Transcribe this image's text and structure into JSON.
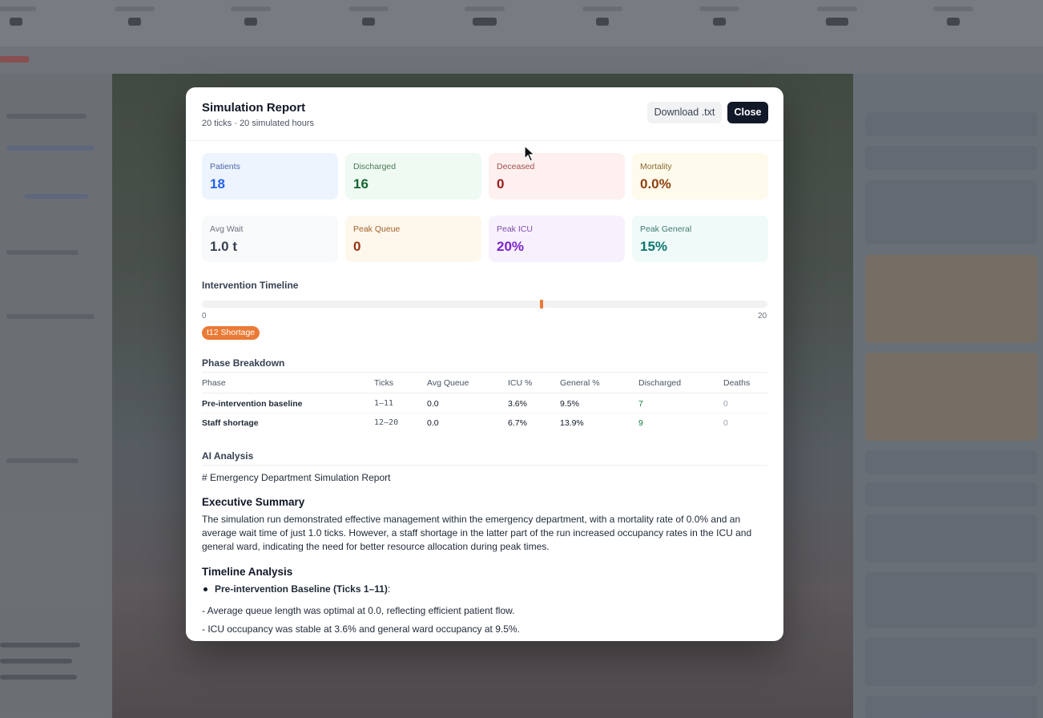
{
  "modal": {
    "title": "Simulation Report",
    "subtitle": "20 ticks · 20 simulated hours",
    "download_label": "Download .txt",
    "close_label": "Close"
  },
  "stats": [
    {
      "label": "Patients",
      "value": "18",
      "label_color": "#4b64a8",
      "value_color": "#2563eb",
      "bg": "#eef4fd"
    },
    {
      "label": "Discharged",
      "value": "16",
      "label_color": "#4b7a58",
      "value_color": "#166534",
      "bg": "#effaf2"
    },
    {
      "label": "Deceased",
      "value": "0",
      "label_color": "#a0504e",
      "value_color": "#991b1b",
      "bg": "#fdf0ef"
    },
    {
      "label": "Mortality",
      "value": "0.0%",
      "label_color": "#8a6a2a",
      "value_color": "#92400e",
      "bg": "#fefaec"
    },
    {
      "label": "Avg Wait",
      "value": "1.0 t",
      "label_color": "#6b7280",
      "value_color": "#374151",
      "bg": "#f8f9fa"
    },
    {
      "label": "Peak Queue",
      "value": "0",
      "label_color": "#a0632a",
      "value_color": "#9a3412",
      "bg": "#fef7ec"
    },
    {
      "label": "Peak ICU",
      "value": "20%",
      "label_color": "#7c4ea8",
      "value_color": "#7e22ce",
      "bg": "#f7f1fd"
    },
    {
      "label": "Peak General",
      "value": "15%",
      "label_color": "#3f7a72",
      "value_color": "#0f766e",
      "bg": "#f0faf8"
    }
  ],
  "timeline": {
    "title": "Intervention Timeline",
    "start_label": "0",
    "end_label": "20",
    "total_ticks": 20,
    "markers": [
      {
        "tick": 12,
        "label": "t12 Shortage",
        "color": "#ea7a35"
      }
    ]
  },
  "phases": {
    "title": "Phase Breakdown",
    "columns": [
      "Phase",
      "Ticks",
      "Avg Queue",
      "ICU %",
      "General %",
      "Discharged",
      "Deaths"
    ],
    "rows": [
      [
        "Pre-intervention baseline",
        "1–11",
        "0.0",
        "3.6%",
        "9.5%",
        "7",
        "0"
      ],
      [
        "Staff shortage",
        "12–20",
        "0.0",
        "6.7%",
        "13.9%",
        "9",
        "0"
      ]
    ]
  },
  "ai": {
    "title": "AI Analysis",
    "heading_line": "# Emergency Department Simulation Report",
    "exec_title": "Executive Summary",
    "exec_text": "The simulation run demonstrated effective management within the emergency department, with a mortality rate of 0.0% and an average wait time of just 1.0 ticks. However, a staff shortage in the latter part of the run increased occupancy rates in the ICU and general ward, indicating the need for better resource allocation during peak times.",
    "timeline_title": "Timeline Analysis",
    "bullet": "Pre-intervention Baseline (Ticks 1–11)",
    "bullet_suffix": ":",
    "lines": [
      "- Average queue length was optimal at 0.0, reflecting efficient patient flow.",
      "- ICU occupancy was stable at 3.6% and general ward occupancy at 9.5%."
    ]
  }
}
